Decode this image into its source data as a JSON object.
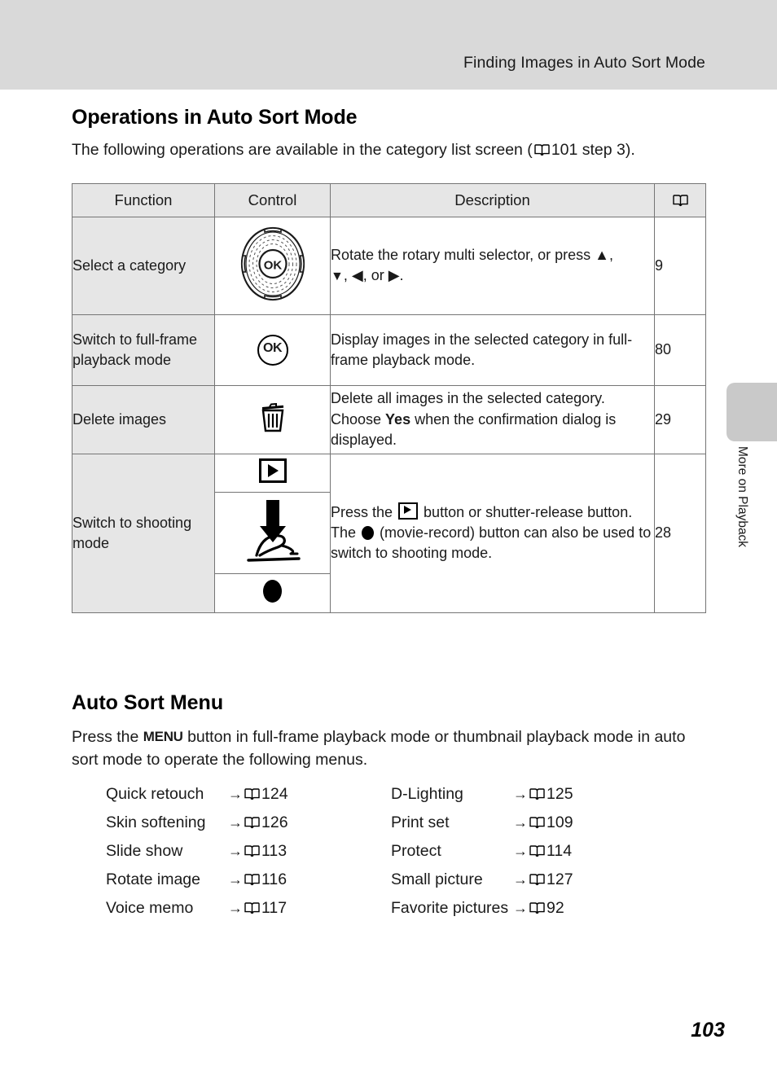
{
  "header": {
    "running_title": "Finding Images in Auto Sort Mode"
  },
  "section": {
    "title": "Operations in Auto Sort Mode",
    "intro_before": "The following operations are available in the category list screen (",
    "intro_ref": "101 step 3).",
    "book_icon": "book-icon"
  },
  "table": {
    "columns": {
      "function": "Function",
      "control": "Control",
      "description": "Description",
      "reference": "book-icon"
    },
    "rows": [
      {
        "function": "Select a category",
        "control_icon": "rotary-multi-selector-icon",
        "description_line1": "Rotate the rotary multi selector, or press ▲,",
        "description_line2_a": "▼",
        "description_line2_b": ", ◀, or ▶.",
        "reference": "9"
      },
      {
        "function": "Switch to full-frame playback mode",
        "control_icon": "ok-button-icon",
        "control_label": "OK",
        "description": "Display images in the selected category in full-frame playback mode.",
        "reference": "80"
      },
      {
        "function": "Delete images",
        "control_icon": "trash-can-icon",
        "description_a": "Delete all images in the selected category. Choose ",
        "description_bold": "Yes",
        "description_b": " when the confirmation dialog is displayed.",
        "reference": "29"
      },
      {
        "function": "Switch to shooting mode",
        "control_icons": [
          "playback-button-icon",
          "shutter-release-button-icon",
          "movie-record-button-icon"
        ],
        "description_a": "Press the ",
        "description_b": " button or shutter-release button. The ",
        "description_c": " (movie-record) button can also be used to switch to shooting mode.",
        "reference": "28"
      }
    ]
  },
  "menu": {
    "title": "Auto Sort Menu",
    "intro_a": "Press the ",
    "intro_menu_glyph": "MENU",
    "intro_b": " button in full-frame playback mode or thumbnail playback mode in auto sort mode to operate the following menus.",
    "arrow": "→",
    "items_left": [
      {
        "label": "Quick retouch",
        "page": "124"
      },
      {
        "label": "Skin softening",
        "page": "126"
      },
      {
        "label": "Slide show",
        "page": "113"
      },
      {
        "label": "Rotate image",
        "page": "116"
      },
      {
        "label": "Voice memo",
        "page": "117"
      }
    ],
    "items_right": [
      {
        "label": "D-Lighting",
        "page": "125"
      },
      {
        "label": "Print set",
        "page": "109"
      },
      {
        "label": "Protect",
        "page": "114"
      },
      {
        "label": "Small picture",
        "page": "127"
      },
      {
        "label": "Favorite pictures",
        "page": "92"
      }
    ]
  },
  "side_tab": {
    "label": "More on Playback"
  },
  "folio": {
    "page_number": "103"
  },
  "colors": {
    "header_bar": "#d9d9d9",
    "table_header_fill": "#e6e6e6",
    "function_col_fill": "#e6e6e6",
    "table_border": "#757575",
    "side_tab": "#c9c9c9"
  }
}
